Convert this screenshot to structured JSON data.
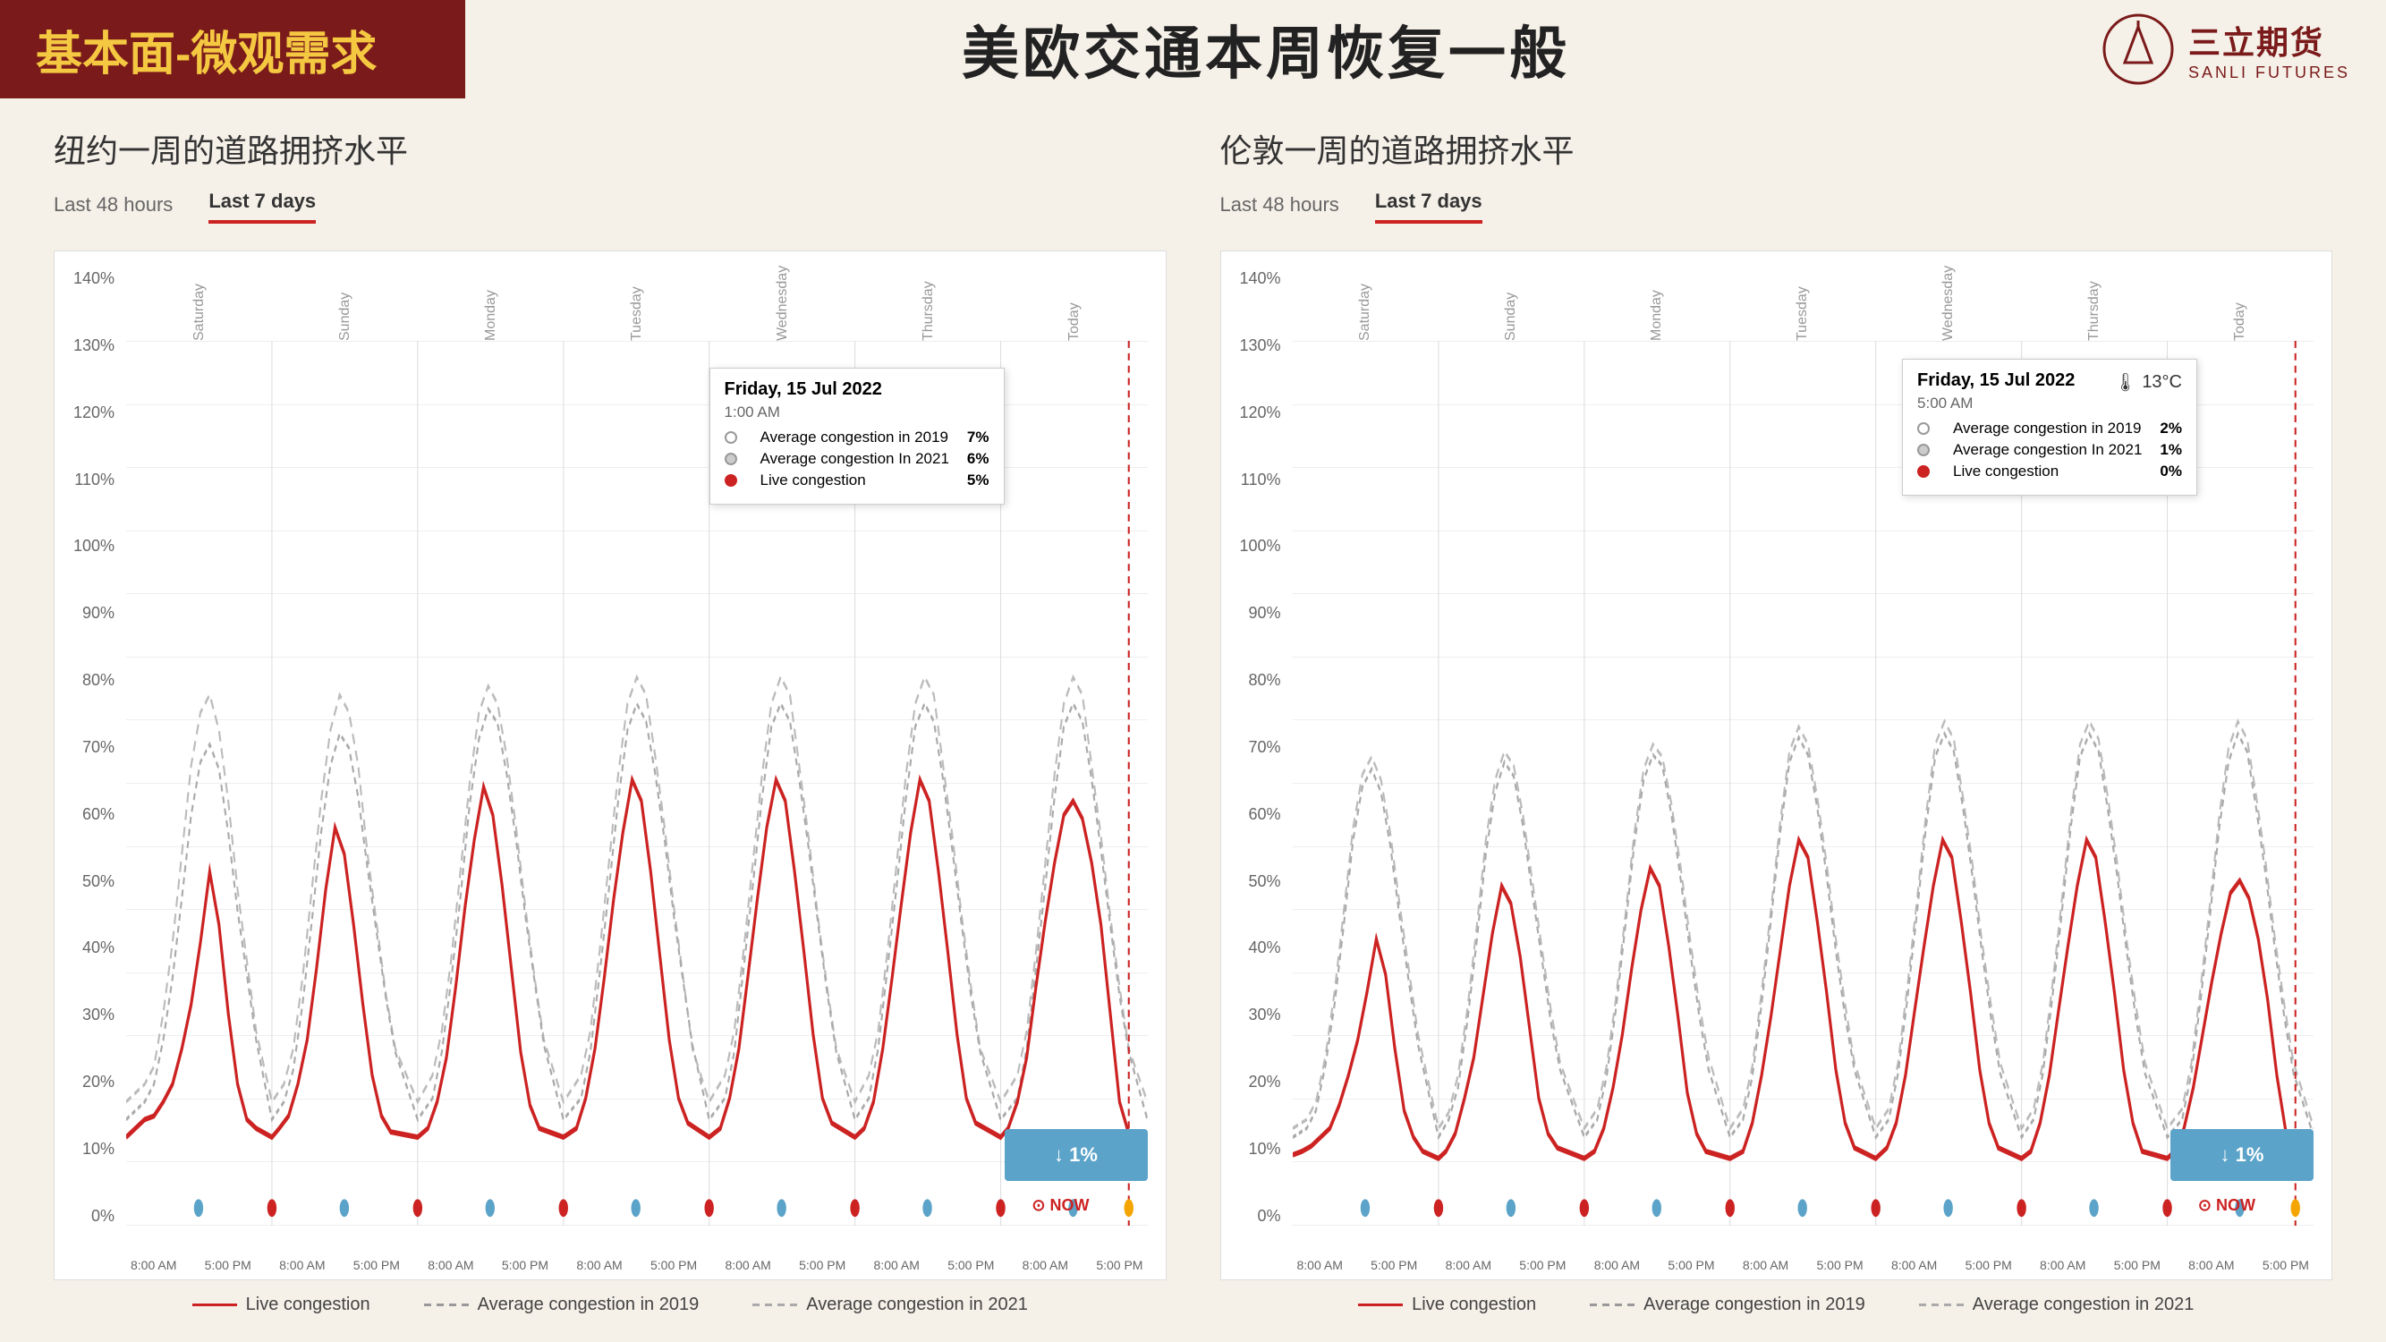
{
  "header": {
    "left_title": "基本面-微观需求",
    "center_title": "美欧交通本周恢复一般",
    "logo_cn": "三立期货",
    "logo_en": "SANLI FUTURES"
  },
  "ny_chart": {
    "section_title": "纽约一周的道路拥挤水平",
    "tabs": [
      "Last 48 hours",
      "Last 7 days"
    ],
    "active_tab": "Last 7 days",
    "y_axis": [
      "140%",
      "130%",
      "120%",
      "110%",
      "100%",
      "90%",
      "80%",
      "70%",
      "60%",
      "50%",
      "40%",
      "30%",
      "20%",
      "10%",
      "0%"
    ],
    "day_labels": [
      "Saturday",
      "Sunday",
      "Monday",
      "Tuesday",
      "Wednesday",
      "Thursday",
      "Today"
    ],
    "x_labels": [
      "8:00 AM",
      "5:00 PM",
      "8:00 AM",
      "5:00 PM",
      "8:00 AM",
      "5:00 PM",
      "8:00 AM",
      "5:00 PM",
      "8:00 AM",
      "5:00 PM",
      "8:00 AM",
      "5:00 PM",
      "8:00 AM",
      "5:00 PM"
    ],
    "tooltip": {
      "date": "Friday, 15 Jul 2022",
      "time": "1:00 AM",
      "avg_2019_label": "Average congestion in 2019",
      "avg_2019_val": "7%",
      "avg_2021_label": "Average congestion In 2021",
      "avg_2021_val": "6%",
      "live_label": "Live congestion",
      "live_val": "5%"
    },
    "blue_box_val": "↓ 1%",
    "now_label": "NOW",
    "legend": {
      "live": "Live congestion",
      "avg_2019": "Average congestion in 2019",
      "avg_2021": "Average congestion in 2021"
    }
  },
  "london_chart": {
    "section_title": "伦敦一周的道路拥挤水平",
    "tabs": [
      "Last 48 hours",
      "Last 7 days"
    ],
    "active_tab": "Last 7 days",
    "y_axis": [
      "140%",
      "130%",
      "120%",
      "110%",
      "100%",
      "90%",
      "80%",
      "70%",
      "60%",
      "50%",
      "40%",
      "30%",
      "20%",
      "10%",
      "0%"
    ],
    "day_labels": [
      "Saturday",
      "Sunday",
      "Monday",
      "Tuesday",
      "Wednesday",
      "Thursday",
      "Today"
    ],
    "x_labels": [
      "8:00 AM",
      "5:00 PM",
      "8:00 AM",
      "5:00 PM",
      "8:00 AM",
      "5:00 PM",
      "8:00 AM",
      "5:00 PM",
      "8:00 AM",
      "5:00 PM",
      "8:00 AM",
      "5:00 PM",
      "8:00 AM",
      "5:00 PM"
    ],
    "tooltip": {
      "date": "Friday, 15 Jul 2022",
      "time": "5:00 AM",
      "temperature": "13°C",
      "avg_2019_label": "Average congestion in 2019",
      "avg_2019_val": "2%",
      "avg_2021_label": "Average congestion In 2021",
      "avg_2021_val": "1%",
      "live_label": "Live congestion",
      "live_val": "0%"
    },
    "blue_box_val": "↓ 1%",
    "now_label": "NOW",
    "legend": {
      "live": "Live congestion",
      "avg_2019": "Average congestion in 2019",
      "avg_2021": "Average congestion in 2021"
    }
  }
}
